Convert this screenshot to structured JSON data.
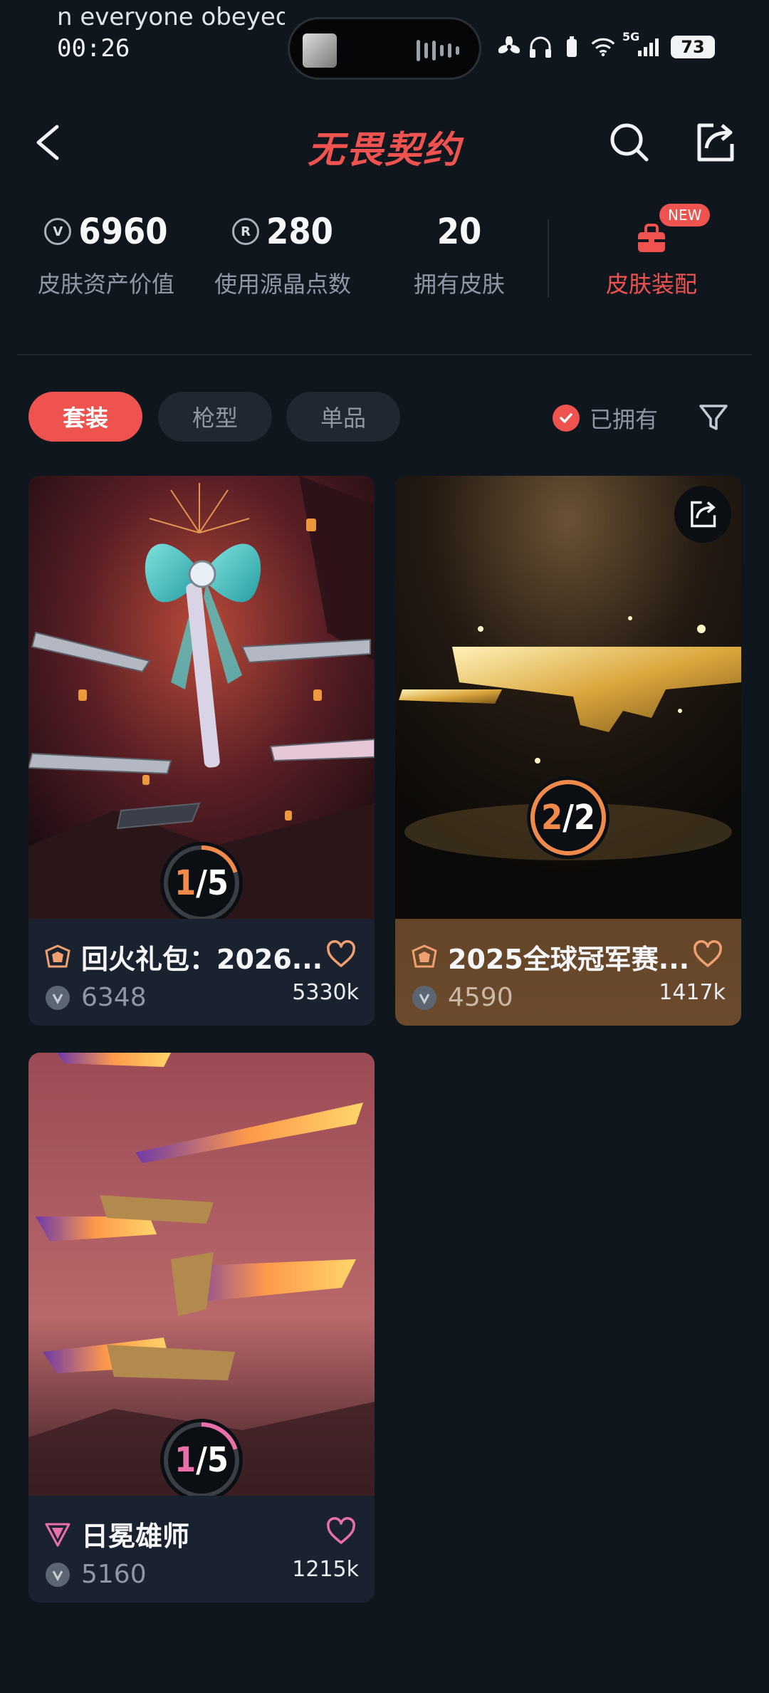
{
  "status_bar": {
    "marquee_text": "n everyone obeyed",
    "time": "00:26",
    "network": "5G",
    "battery": "73"
  },
  "header": {
    "title": "无畏契约",
    "icons": [
      "back-icon",
      "search-icon",
      "share-icon"
    ]
  },
  "stats": {
    "asset_value": {
      "value": "6960",
      "label": "皮肤资产价值",
      "coin": "V"
    },
    "radianite": {
      "value": "280",
      "label": "使用源晶点数",
      "coin": "R"
    },
    "owned_skins": {
      "value": "20",
      "label": "拥有皮肤"
    },
    "equip": {
      "label": "皮肤装配",
      "badge": "NEW"
    }
  },
  "filters": {
    "tabs": [
      {
        "label": "套装",
        "active": true
      },
      {
        "label": "枪型",
        "active": false
      },
      {
        "label": "单品",
        "active": false
      }
    ],
    "owned_label": "已拥有",
    "owned_checked": true
  },
  "cards": [
    {
      "title": "回火礼包：2026...",
      "price": "6348",
      "likes": "5330k",
      "progress": "1/5",
      "progress_fraction": 0.2,
      "tier_color": "#f0a070",
      "ring_color": "#f08a4b"
    },
    {
      "title": "2025全球冠军赛...",
      "price": "4590",
      "likes": "1417k",
      "progress": "2/2",
      "progress_fraction": 1.0,
      "tier_color": "#f0a070",
      "ring_color": "#f08a4b"
    },
    {
      "title": "日冕雄师",
      "price": "5160",
      "likes": "1215k",
      "progress": "1/5",
      "progress_fraction": 0.2,
      "tier_color": "#e86fa8",
      "ring_color": "#e86fa8"
    }
  ],
  "colors": {
    "accent": "#ef5350",
    "background": "#0f161e",
    "card": "#1a2230",
    "gold_card": "#5b3e22"
  }
}
